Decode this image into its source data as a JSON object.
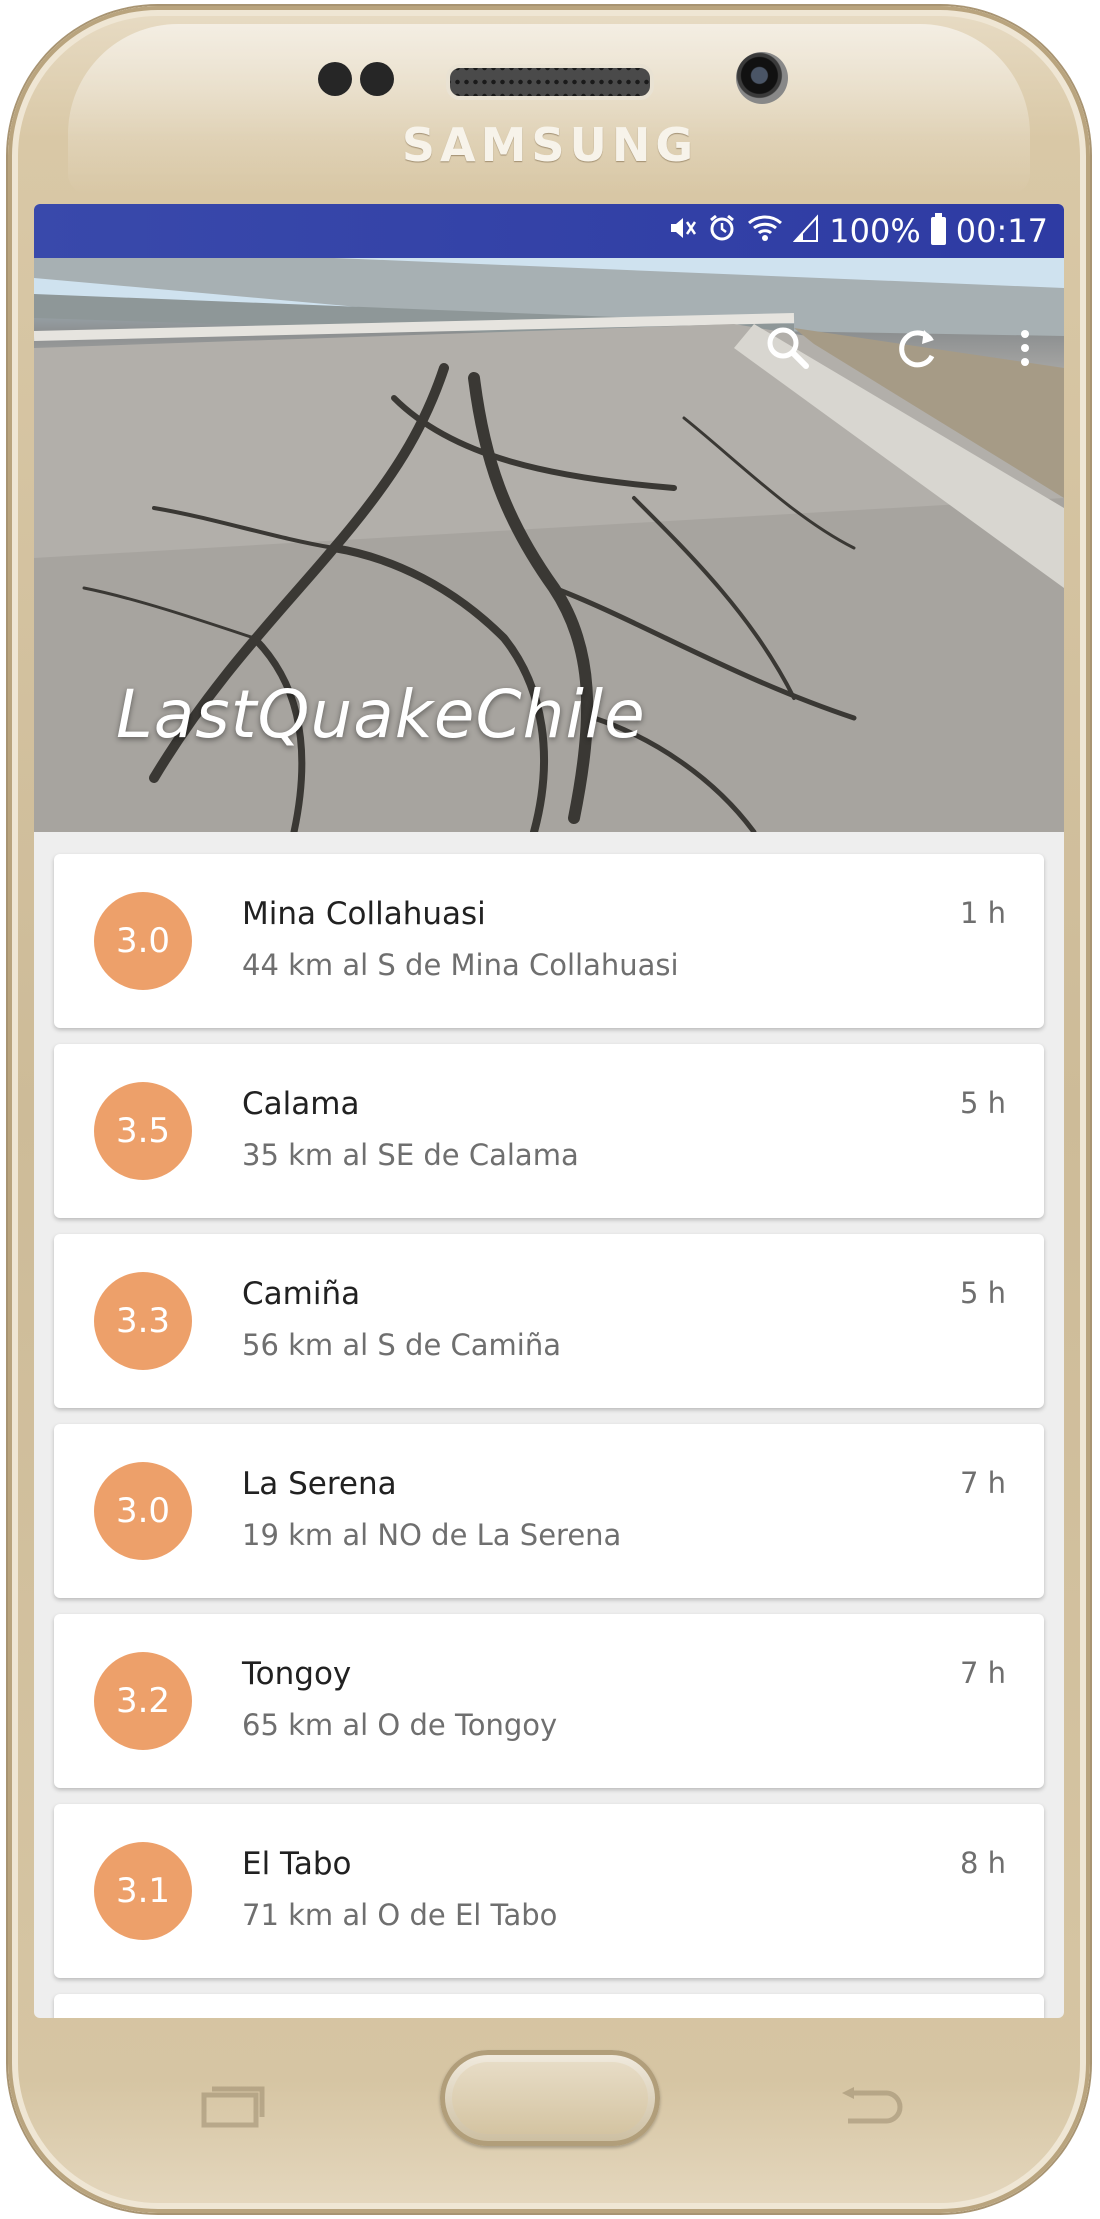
{
  "device": {
    "brand": "SAMSUNG"
  },
  "status_bar": {
    "battery": "100%",
    "time": "00:17",
    "icons": [
      "mute-icon",
      "alarm-icon",
      "wifi-icon",
      "signal-icon",
      "battery-icon"
    ]
  },
  "app": {
    "title": "LastQuakeChile",
    "actions": [
      "search-icon",
      "refresh-icon",
      "more-vert-icon"
    ]
  },
  "colors": {
    "status_bar": "#3949ab",
    "magnitude_badge": "#eda06a",
    "card": "#ffffff",
    "list_background": "#eeeeee"
  },
  "quakes": [
    {
      "magnitude": "3.0",
      "place": "Mina Collahuasi",
      "description": "44 km al S de Mina Collahuasi",
      "time": "1 h"
    },
    {
      "magnitude": "3.5",
      "place": "Calama",
      "description": "35 km al SE de Calama",
      "time": "5 h"
    },
    {
      "magnitude": "3.3",
      "place": "Camiña",
      "description": "56 km al S de Camiña",
      "time": "5 h"
    },
    {
      "magnitude": "3.0",
      "place": "La Serena",
      "description": "19 km al NO de La Serena",
      "time": "7 h"
    },
    {
      "magnitude": "3.2",
      "place": "Tongoy",
      "description": "65 km al O de Tongoy",
      "time": "7 h"
    },
    {
      "magnitude": "3.1",
      "place": "El Tabo",
      "description": "71 km al O de El Tabo",
      "time": "8 h"
    }
  ]
}
